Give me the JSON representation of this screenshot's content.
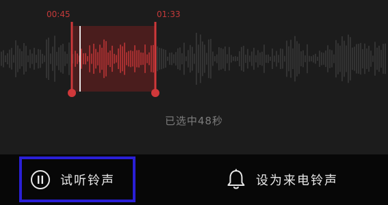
{
  "editor": {
    "start_time": "00:45",
    "end_time": "01:33",
    "selected_text": "已选中48秒",
    "accent_color": "#d0383a",
    "waveform_color": "#3e3e3e"
  },
  "actions": {
    "preview_label": "试听铃声",
    "set_ringtone_label": "设为来电铃声"
  },
  "colors": {
    "highlight_border": "#2a1fd6"
  }
}
